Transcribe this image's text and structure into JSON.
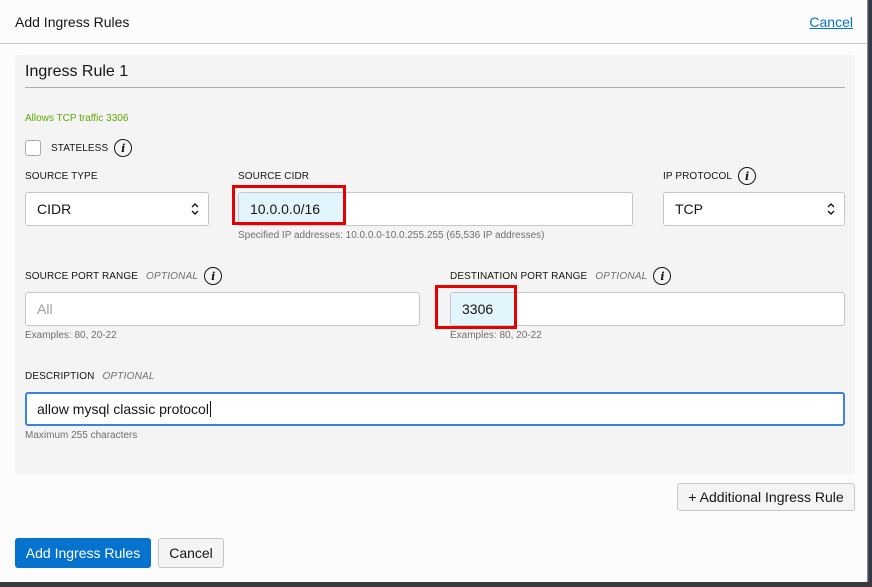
{
  "dialog": {
    "title": "Add Ingress Rules",
    "cancel_link": "Cancel"
  },
  "rule": {
    "title": "Ingress Rule 1",
    "summary": "Allows TCP traffic 3306",
    "stateless": {
      "label": "STATELESS",
      "checked": false,
      "info_icon": "info-icon"
    },
    "source_type": {
      "label": "SOURCE TYPE",
      "value": "CIDR",
      "icon": "chevron-updown-icon"
    },
    "source_cidr": {
      "label": "SOURCE CIDR",
      "value": "10.0.0.0/16",
      "helper": "Specified IP addresses: 10.0.0.0-10.0.255.255 (65,536 IP addresses)"
    },
    "ip_protocol": {
      "label": "IP PROTOCOL",
      "value": "TCP",
      "icon": "chevron-updown-icon",
      "info_icon": "info-icon"
    },
    "source_port_range": {
      "label": "SOURCE PORT RANGE",
      "optional": "OPTIONAL",
      "placeholder": "All",
      "value": "",
      "helper": "Examples: 80, 20-22",
      "info_icon": "info-icon"
    },
    "destination_port_range": {
      "label": "DESTINATION PORT RANGE",
      "optional": "OPTIONAL",
      "value": "3306",
      "helper": "Examples: 80, 20-22",
      "info_icon": "info-icon"
    },
    "description": {
      "label": "DESCRIPTION",
      "optional": "OPTIONAL",
      "value": "allow mysql classic protocol",
      "helper": "Maximum 255 characters"
    }
  },
  "buttons": {
    "additional_rule": "+ Additional Ingress Rule",
    "add_rules": "Add Ingress Rules",
    "cancel": "Cancel"
  },
  "colors": {
    "primary": "#0572ce",
    "summary_green": "#5ea900",
    "highlight_box": "#e60000",
    "autofill_bg": "#e2f5fc"
  }
}
